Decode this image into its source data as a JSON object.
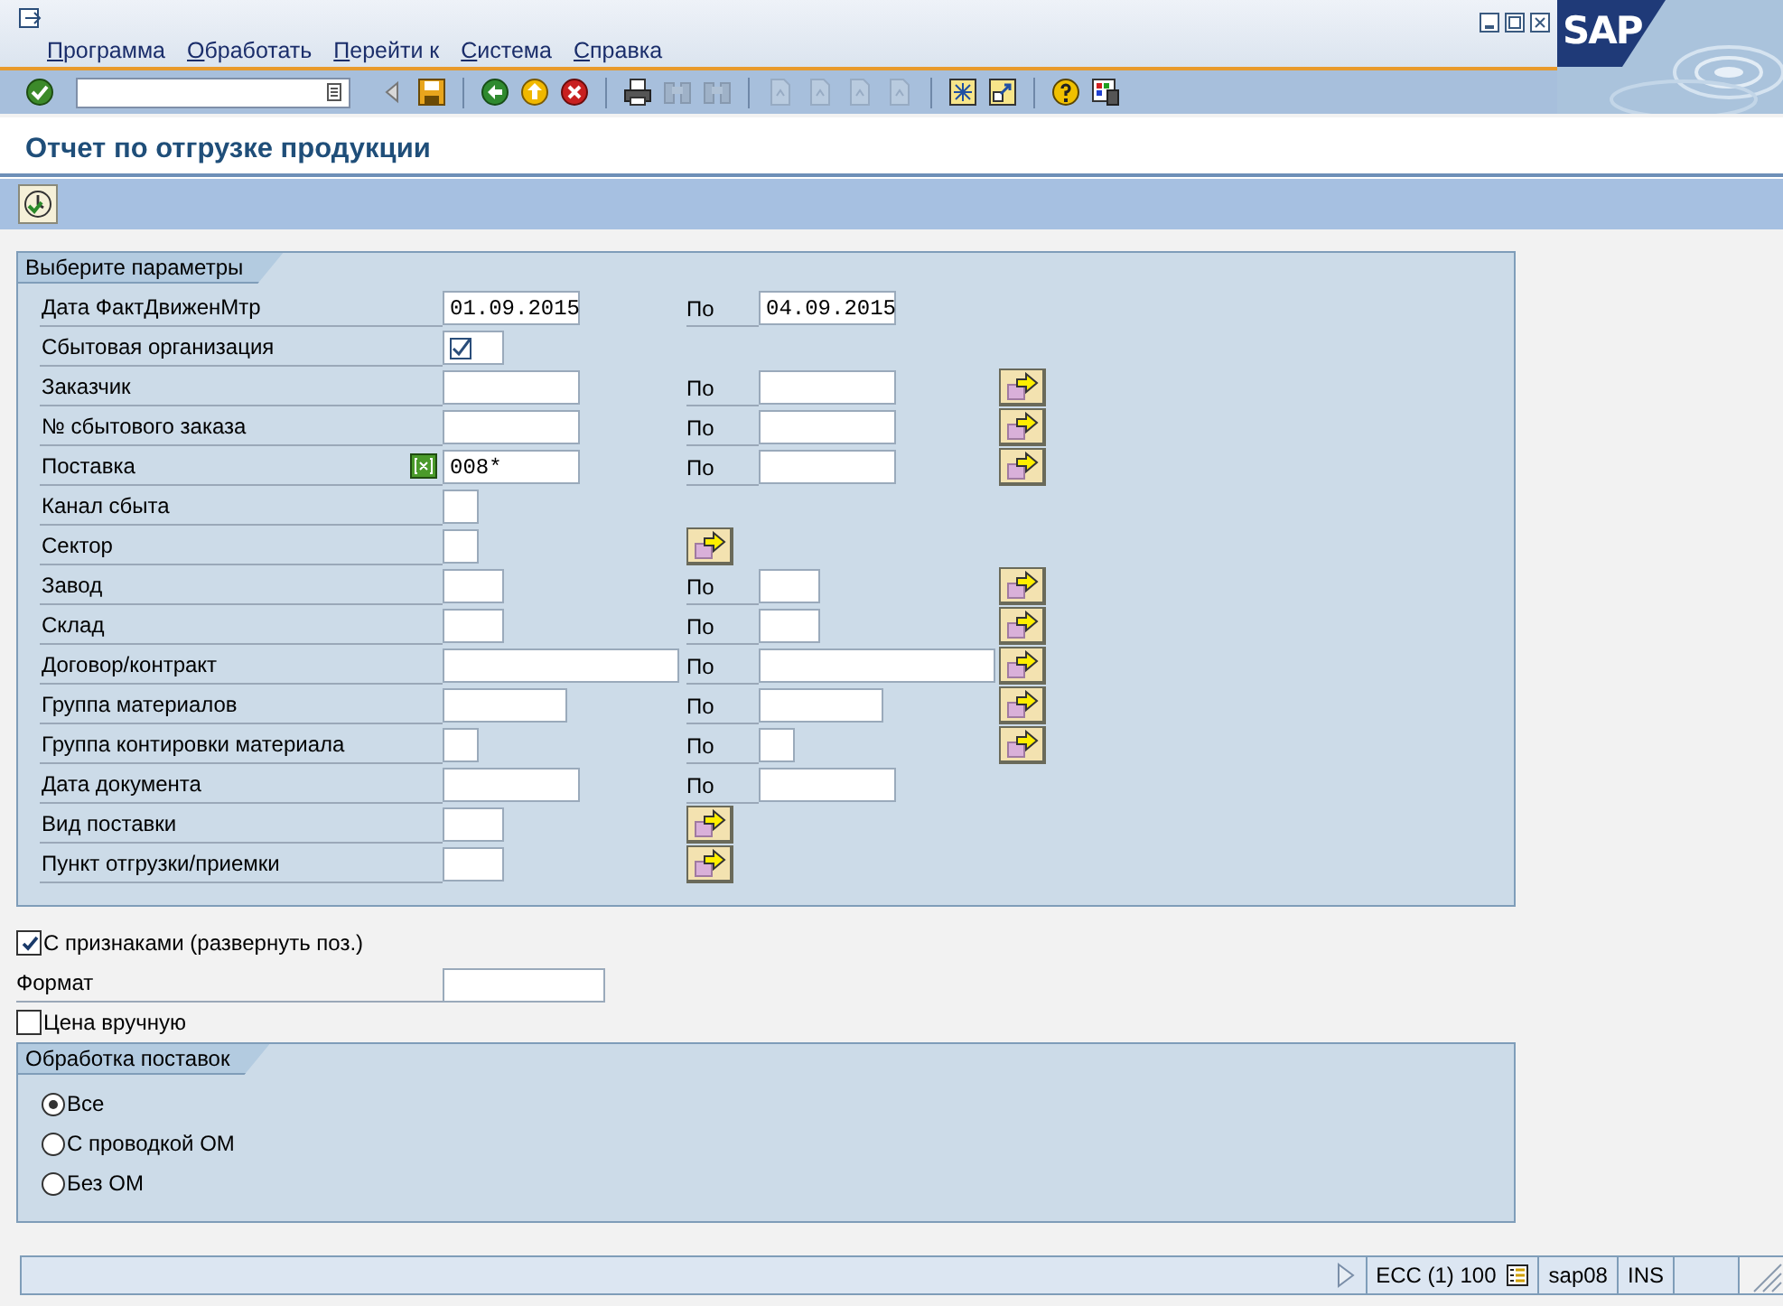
{
  "menu": [
    "Программа",
    "Обработать",
    "Перейти к",
    "Система",
    "Справка"
  ],
  "logo": "SAP",
  "toolbar": [
    {
      "kind": "check",
      "disabled": false
    },
    {
      "kind": "field"
    },
    {
      "kind": "arrow-left",
      "disabled": false
    },
    {
      "kind": "save",
      "disabled": false
    },
    {
      "kind": "sep"
    },
    {
      "kind": "back",
      "disabled": false
    },
    {
      "kind": "exit",
      "disabled": false
    },
    {
      "kind": "cancel",
      "disabled": false
    },
    {
      "kind": "sep"
    },
    {
      "kind": "print",
      "disabled": false
    },
    {
      "kind": "find",
      "disabled": true
    },
    {
      "kind": "find",
      "disabled": true
    },
    {
      "kind": "sep"
    },
    {
      "kind": "page",
      "disabled": true
    },
    {
      "kind": "page",
      "disabled": true
    },
    {
      "kind": "page",
      "disabled": true
    },
    {
      "kind": "page",
      "disabled": true
    },
    {
      "kind": "sep"
    },
    {
      "kind": "window",
      "disabled": false
    },
    {
      "kind": "shortcut",
      "disabled": false
    },
    {
      "kind": "sep"
    },
    {
      "kind": "help",
      "disabled": false
    },
    {
      "kind": "layout",
      "disabled": false
    }
  ],
  "title": "Отчет по отгрузке продукции",
  "params": {
    "title": "Выберите параметры",
    "rows": [
      {
        "kind": "range",
        "label": "Дата ФактДвиженМтр",
        "value": "01.09.2015",
        "to_label": "По",
        "to_value": "04.09.2015",
        "more_button": false,
        "multi_active": false
      },
      {
        "kind": "checkbox",
        "label": "Сбытовая организация",
        "checked": true
      },
      {
        "kind": "range",
        "label": "Заказчик",
        "to_label": "По",
        "more_button": true,
        "multi_active": false
      },
      {
        "kind": "range",
        "label": "№ сбытового заказа",
        "to_label": "По",
        "more_button": true,
        "multi_active": false
      },
      {
        "kind": "range",
        "label": "Поставка",
        "value": "008*",
        "to_label": "По",
        "more_button": true,
        "multi_active": true
      },
      {
        "kind": "single",
        "label": "Канал сбыта",
        "more_button": false
      },
      {
        "kind": "single",
        "label": "Сектор",
        "more_button": true
      },
      {
        "kind": "range",
        "label": "Завод",
        "to_label": "По",
        "more_button": true,
        "multi_active": false
      },
      {
        "kind": "range",
        "label": "Склад",
        "to_label": "По",
        "more_button": true,
        "multi_active": false
      },
      {
        "kind": "range",
        "label": "Договор/контракт",
        "to_label": "По",
        "more_button": true,
        "multi_active": false
      },
      {
        "kind": "range",
        "label": "Группа материалов",
        "to_label": "По",
        "more_button": true,
        "multi_active": false
      },
      {
        "kind": "range",
        "label": "Группа контировки материала",
        "to_label": "По",
        "more_button": true,
        "multi_active": false
      },
      {
        "kind": "range",
        "label": "Дата документа",
        "to_label": "По",
        "more_button": false,
        "multi_active": false
      },
      {
        "kind": "single",
        "label": "Вид поставки",
        "more_button": true
      },
      {
        "kind": "single",
        "label": "Пункт отгрузки/приемки",
        "more_button": true
      }
    ]
  },
  "with_features": {
    "label": "С признаками (развернуть поз.)",
    "checked": true
  },
  "format": {
    "label": "Формат"
  },
  "manual_price": {
    "label": "Цена вручную",
    "checked": false
  },
  "processing": {
    "title": "Обработка поставок",
    "options": [
      {
        "label": "Все",
        "selected": true
      },
      {
        "label": "С проводкой ОМ",
        "selected": false
      },
      {
        "label": "Без ОМ",
        "selected": false
      }
    ]
  },
  "status": {
    "system": "ECC (1) 100",
    "server": "sap08",
    "mode": "INS"
  }
}
